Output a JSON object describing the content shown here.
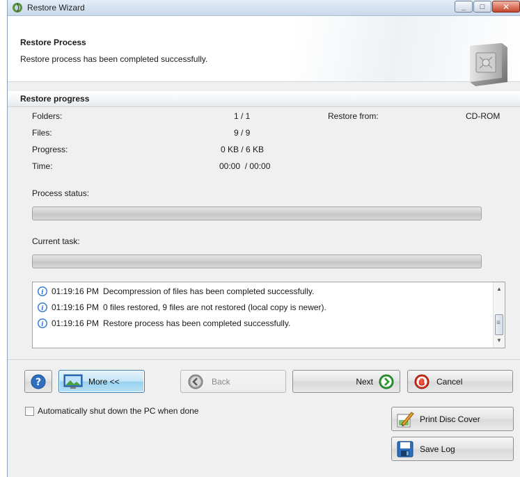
{
  "window": {
    "title": "Restore Wizard"
  },
  "header": {
    "title": "Restore Process",
    "subtitle": "Restore process has been completed successfully."
  },
  "progress": {
    "section_title": "Restore progress",
    "folders_label": "Folders:",
    "folders_value": "1 / 1",
    "files_label": "Files:",
    "files_value": "9 / 9",
    "progress_label": "Progress:",
    "progress_value": "0 KB / 6 KB",
    "time_label": "Time:",
    "time_value": "00:00  / 00:00",
    "restore_from_label": "Restore from:",
    "restore_from_value": "CD-ROM",
    "process_status_label": "Process status:",
    "process_status_fraction": 0,
    "current_task_label": "Current task:",
    "current_task_fraction": 0
  },
  "log": {
    "entries": [
      {
        "time": "01:19:16 PM",
        "message": "Decompression of files has been completed successfully."
      },
      {
        "time": "01:19:16 PM",
        "message": "0 files restored, 9 files are not restored (local copy is newer)."
      },
      {
        "time": "01:19:16 PM",
        "message": "Restore process has been completed successfully."
      }
    ]
  },
  "buttons": {
    "more": "More <<",
    "back": "Back",
    "next": "Next",
    "cancel": "Cancel",
    "print_disc_cover": "Print Disc Cover",
    "save_log": "Save Log"
  },
  "options": {
    "auto_shutdown_label": "Automatically shut down the PC when done",
    "auto_shutdown_checked": false
  },
  "colors": {
    "help_blue": "#2d6fc0",
    "next_green": "#2e9b35",
    "cancel_red": "#d0311f",
    "info_blue": "#3a7fd0"
  }
}
